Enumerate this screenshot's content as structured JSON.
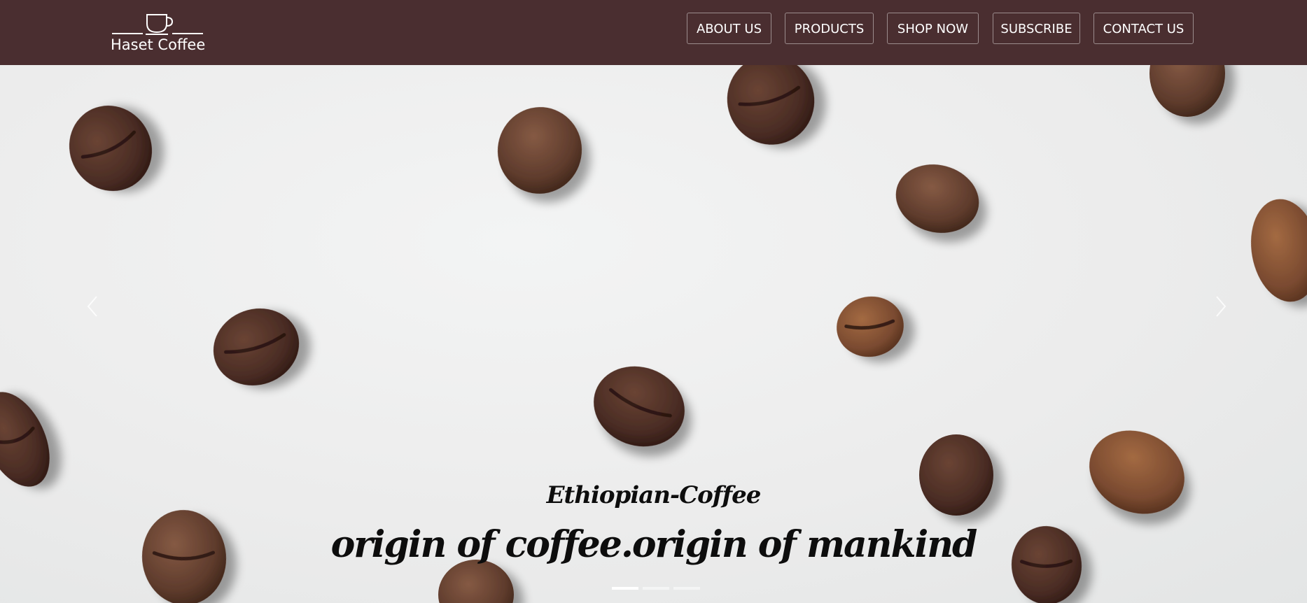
{
  "brand": {
    "name": "Haset Coffee",
    "icon": "coffee-cup-icon"
  },
  "nav": {
    "items": [
      {
        "label": "ABOUT US"
      },
      {
        "label": "PRODUCTS"
      },
      {
        "label": "SHOP NOW"
      },
      {
        "label": "SUBSCRIBE"
      },
      {
        "label": "CONTACT US"
      }
    ]
  },
  "hero": {
    "subtitle": "Ethiopian-Coffee",
    "title": "origin of coffee.origin of mankind",
    "prev_icon": "chevron-left-icon",
    "next_icon": "chevron-right-icon",
    "slides": 3,
    "active_slide": 0
  },
  "colors": {
    "navbar": "#4a2e30",
    "bean_dark": "#4a2c24",
    "bean_light": "#7a4a30",
    "text": "#0d0d0d"
  }
}
